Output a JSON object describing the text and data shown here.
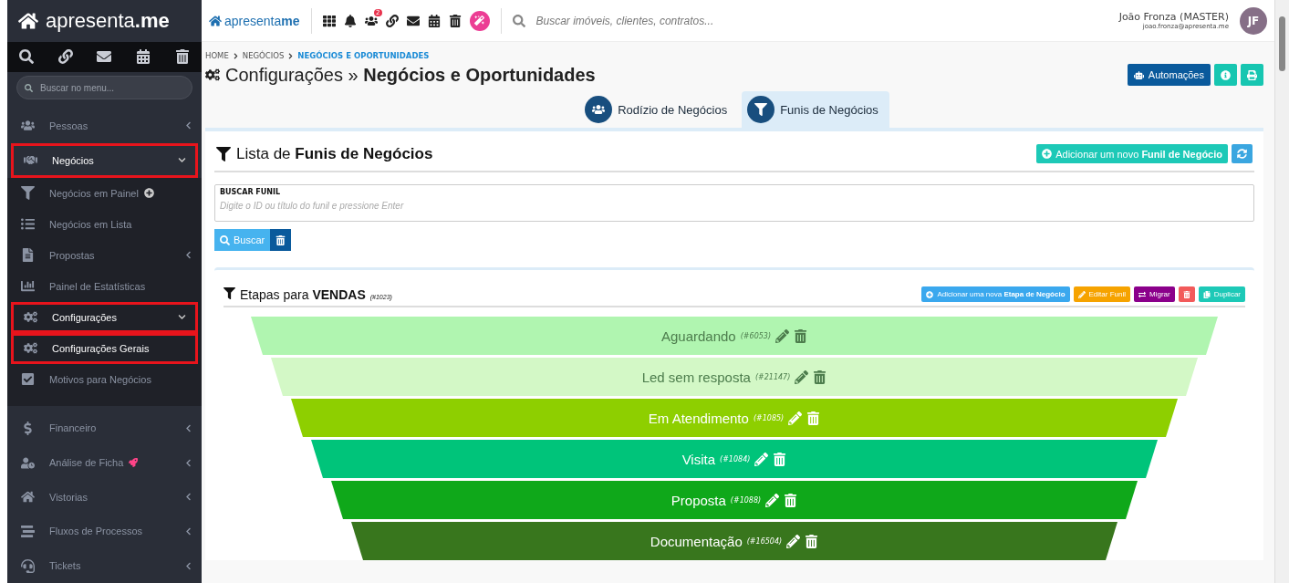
{
  "sidebar": {
    "logo": "apresenta**.me**",
    "search": {
      "placeholder": "Buscar no menu..."
    },
    "items": [
      {
        "label": "Pessoas",
        "expanded": false,
        "active": false,
        "highlighted": false
      },
      {
        "label": "Negócios",
        "expanded": true,
        "active": true,
        "highlighted": true,
        "children": [
          {
            "label": "Negócios em Painel",
            "active": false,
            "highlighted": false
          },
          {
            "label": "Negócios em Lista",
            "active": false,
            "highlighted": false
          },
          {
            "label": "Propostas",
            "expanded": false,
            "active": false,
            "highlighted": false
          },
          {
            "label": "Painel de Estatísticas",
            "active": false,
            "highlighted": false
          },
          {
            "label": "Configurações",
            "expanded": true,
            "active": true,
            "highlighted": true,
            "children": [
              {
                "label": "Configurações Gerais",
                "active": true,
                "highlighted": true
              },
              {
                "label": "Motivos para Negócios",
                "active": false,
                "highlighted": false
              }
            ]
          }
        ]
      },
      {
        "label": "Financeiro",
        "expanded": false,
        "active": false,
        "highlighted": false
      },
      {
        "label": "Análise de Ficha",
        "expanded": false,
        "active": false,
        "highlighted": false
      },
      {
        "label": "Vistorias",
        "expanded": false,
        "active": false,
        "highlighted": false
      },
      {
        "label": "Fluxos de Processos",
        "expanded": false,
        "active": false,
        "highlighted": false
      },
      {
        "label": "Tickets",
        "expanded": false,
        "active": false,
        "highlighted": false
      }
    ]
  },
  "topbar": {
    "logo": "apresenta**me**",
    "badge": "2",
    "search": {
      "placeholder": "Buscar imóveis, clientes, contratos..."
    },
    "user": {
      "name": "João Fronza (MASTER)",
      "email": "joao.fronza@apresenta.me",
      "initials": "JF"
    }
  },
  "breadcrumb": [
    {
      "label": "HOME",
      "current": false
    },
    {
      "label": "NEGÓCIOS",
      "current": false
    },
    {
      "label": "NEGÓCIOS E OPORTUNIDADES",
      "current": true
    }
  ],
  "page_title": {
    "prefix": "Configurações »",
    "main": "Negócios e Oportunidades"
  },
  "header_buttons": [
    {
      "kind": "automations",
      "label": "Automações"
    },
    {
      "kind": "info"
    },
    {
      "kind": "print"
    }
  ],
  "tabs": [
    {
      "label": "Rodízio de Negócios",
      "selected": false
    },
    {
      "label": "Funis de Negócios",
      "selected": true
    }
  ],
  "funnel_list": {
    "title_prefix": "Lista de",
    "title": "Funis de Negócios",
    "add_button": "Adicionar um novo **Funil de Negócio**",
    "search": {
      "label": "BUSCAR FUNIL",
      "placeholder": "Digite o ID ou título do funil e pressione Enter"
    },
    "search_button": "Buscar"
  },
  "funnel": {
    "title_prefix": "Etapas para",
    "name": "VENDAS",
    "id": "(#1023)",
    "actions": [
      {
        "kind": "add",
        "label": "Adicionar uma nova **Etapa de Negócio**"
      },
      {
        "kind": "edit",
        "label": "Editar Funil"
      },
      {
        "kind": "migrate",
        "label": "Migrar"
      },
      {
        "kind": "delete"
      },
      {
        "kind": "duplicate",
        "label": "Duplicar"
      }
    ],
    "stages": [
      {
        "name": "Aguardando",
        "id": "(#6053)",
        "color": "#b0f5b0"
      },
      {
        "name": "Led sem resposta",
        "id": "(#21147)",
        "color": "#d3f8c6"
      },
      {
        "name": "Em Atendimento",
        "id": "(#1085)",
        "color": "#8ecf00"
      },
      {
        "name": "Visita",
        "id": "(#1084)",
        "color": "#00c47a"
      },
      {
        "name": "Proposta",
        "id": "(#1088)",
        "color": "#0fa81a"
      },
      {
        "name": "Documentação",
        "id": "(#16504)",
        "color": "#38761d"
      }
    ]
  }
}
